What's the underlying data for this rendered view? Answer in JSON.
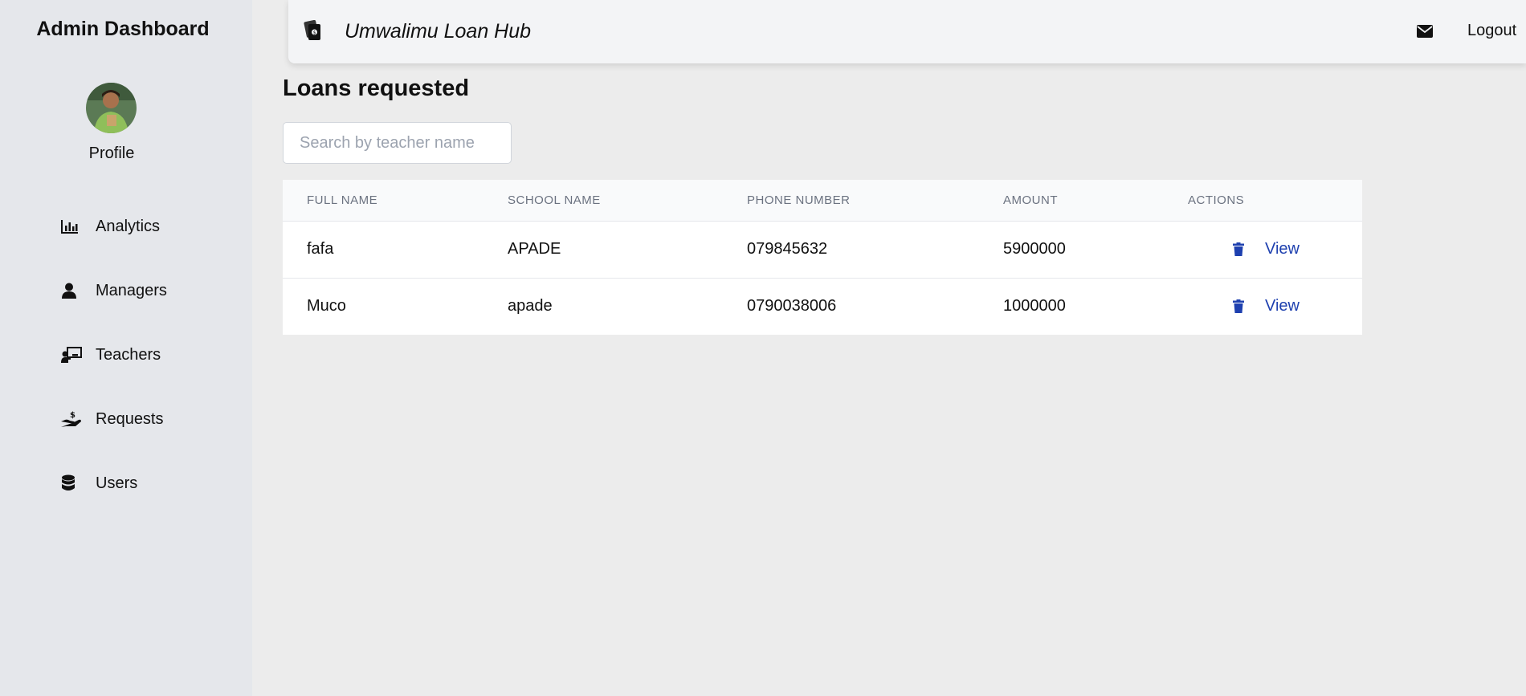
{
  "sidebar": {
    "title": "Admin Dashboard",
    "profile_label": "Profile",
    "items": [
      {
        "label": "Analytics",
        "icon": "chart-bar-icon"
      },
      {
        "label": "Managers",
        "icon": "user-icon"
      },
      {
        "label": "Teachers",
        "icon": "chalkboard-teacher-icon"
      },
      {
        "label": "Requests",
        "icon": "hand-holding-dollar-icon"
      },
      {
        "label": "Users",
        "icon": "database-icon"
      }
    ]
  },
  "header": {
    "brand": "Umwalimu Loan Hub",
    "brand_icon": "money-bills-icon",
    "mail_icon": "envelope-icon",
    "logout_label": "Logout"
  },
  "main": {
    "title": "Loans requested",
    "search_placeholder": "Search by teacher name",
    "table": {
      "headers": [
        "FULL NAME",
        "SCHOOL NAME",
        "PHONE NUMBER",
        "AMOUNT",
        "ACTIONS"
      ],
      "rows": [
        {
          "full_name": "fafa",
          "school_name": "APADE",
          "phone": "079845632",
          "amount": "5900000",
          "view_label": "View"
        },
        {
          "full_name": "Muco",
          "school_name": "apade",
          "phone": "0790038006",
          "amount": "1000000",
          "view_label": "View"
        }
      ]
    }
  },
  "colors": {
    "sidebar_bg": "#e5e7eb",
    "page_bg": "#ececec",
    "link": "#1e40af"
  }
}
